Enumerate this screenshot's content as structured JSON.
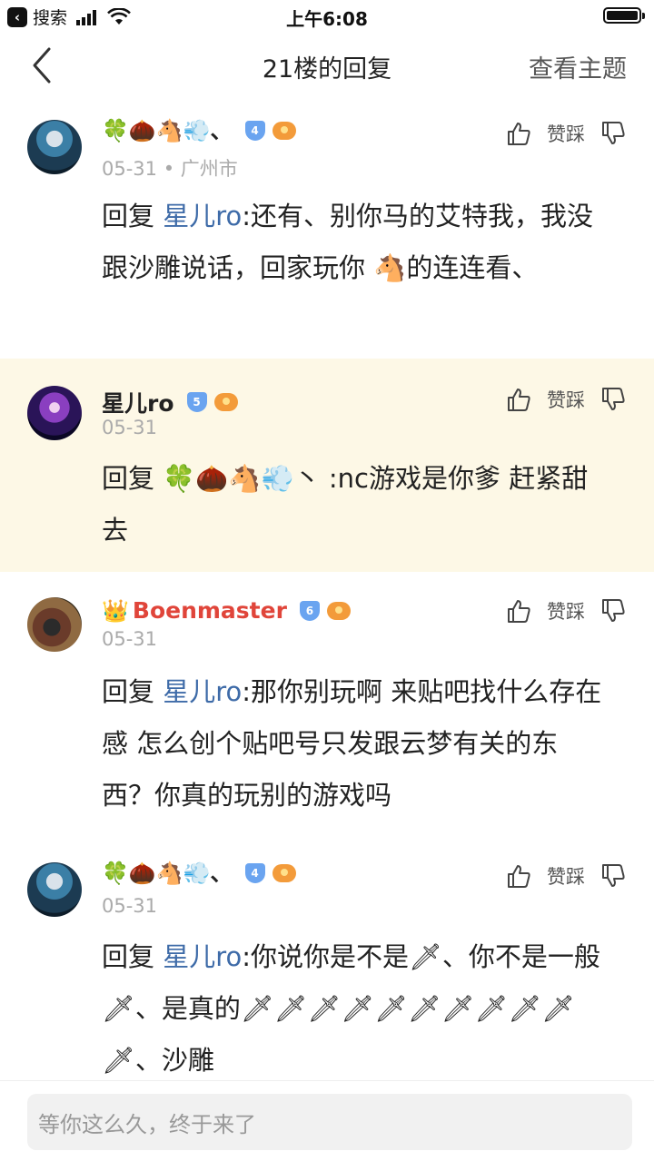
{
  "status_bar": {
    "back_app_label": "搜索",
    "time": "上午6:08",
    "battery_level": 1.0
  },
  "nav": {
    "title": "21楼的回复",
    "right_action": "查看主题"
  },
  "action_label": "赞踩",
  "posts": [
    {
      "user_emojis": "🍀🌰🐴💨、",
      "level": "4",
      "date": "05-31",
      "location": "广州市",
      "reply_prefix": "回复 ",
      "mention": "星儿ro",
      "text": ":还有、别你马的艾特我，我没跟沙雕说话，回家玩你 🐴的连连看、"
    },
    {
      "username": "星儿ro",
      "level": "5",
      "date": "05-31",
      "reply_prefix": "回复 ",
      "mention_plain": "🍀🌰🐴💨丶",
      "text": " :nc游戏是你爹 赶紧甜去"
    },
    {
      "crown": "👑",
      "username": "Boenmaster",
      "level": "6",
      "date": "05-31",
      "reply_prefix": "回复 ",
      "mention": "星儿ro",
      "text": ":那你别玩啊 来贴吧找什么存在感 怎么创个贴吧号只发跟云梦有关的东西？你真的玩别的游戏吗"
    },
    {
      "user_emojis": "🍀🌰🐴💨、",
      "level": "4",
      "date": "05-31",
      "reply_prefix": "回复 ",
      "mention": "星儿ro",
      "text": ":你说你是不是🗡、你不是一般🗡、是真的🗡🗡🗡🗡🗡🗡🗡🗡🗡🗡🗡、沙雕"
    }
  ],
  "bottom": {
    "placeholder": "等你这么久，终于来了"
  },
  "colors": {
    "highlight_bg": "#fdf8e6",
    "link": "#3e6ba8",
    "vip_name": "#e0453a",
    "meta_text": "#aaaaaa"
  }
}
